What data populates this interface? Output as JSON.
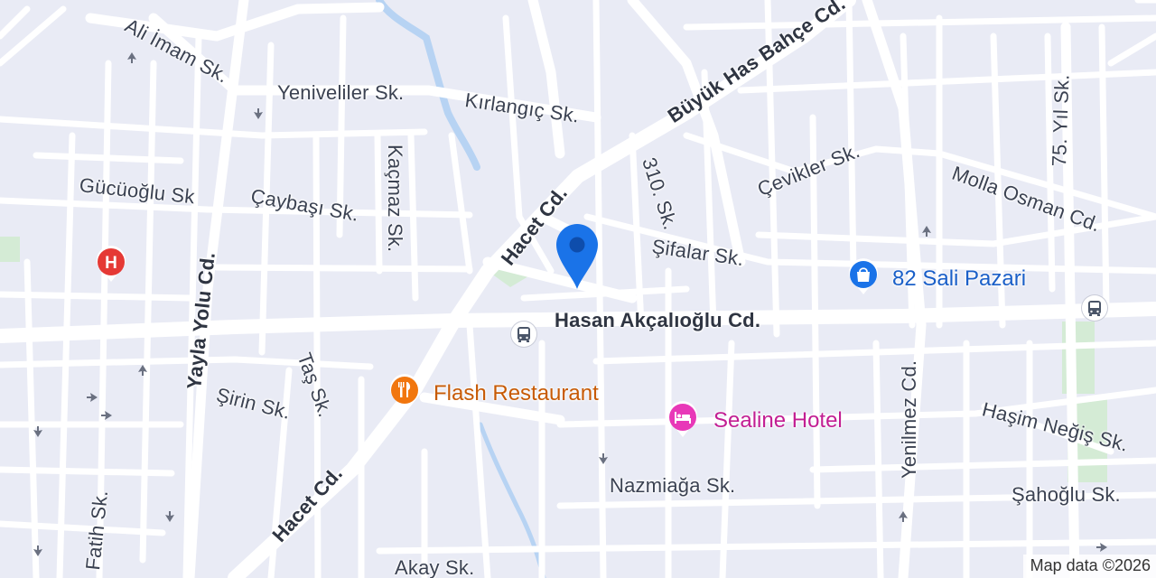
{
  "map": {
    "streets": {
      "ali_imam": "Ali İmam Sk.",
      "yeniveliler": "Yeniveliler Sk.",
      "kirlangic": "Kırlangıç Sk.",
      "buyuk_has_bahce": "Büyük Has Bahçe Cd.",
      "kacmaz": "Kaçmaz Sk.",
      "sk_310": "310. Sk.",
      "cevikler": "Çevikler Sk.",
      "molla_osman": "Molla Osman Cd.",
      "yil_75": "75. Yıl Sk.",
      "gucuoglu": "Gücüoğlu Sk",
      "caybasi": "Çaybaşı Sk.",
      "hacet_upper": "Hacet Cd.",
      "sifalar": "Şifalar Sk.",
      "yayla_yolu": "Yayla Yolu Cd.",
      "hasan_akcalioglu": "Hasan Akçalıoğlu Cd.",
      "tas": "Taş Sk.",
      "sirin": "Şirin Sk.",
      "yenilmez": "Yenilmez Cd.",
      "hasim_negis": "Haşim Neğiş Sk.",
      "fatih": "Fatih Sk.",
      "hacet_lower": "Hacet Cd.",
      "nazmiaga": "Nazmiağa Sk.",
      "sahoglu": "Şahoğlu Sk.",
      "akay": "Akay Sk."
    },
    "pois": {
      "market": {
        "name": "82 Sali Pazari",
        "color": "#1a73e8",
        "icon": "shopping-bag-icon"
      },
      "restaurant": {
        "name": "Flash Restaurant",
        "color": "#f1760e",
        "icon": "fork-knife-icon"
      },
      "hotel": {
        "name": "Sealine Hotel",
        "color": "#e838b8",
        "icon": "bed-icon"
      },
      "hospital": {
        "icon": "hospital-icon",
        "letter": "H",
        "color": "#e53935"
      }
    },
    "location_pin": {
      "color": "#1a73e8",
      "icon": "location-pin-icon"
    },
    "attribution": "Map data ©2026"
  }
}
